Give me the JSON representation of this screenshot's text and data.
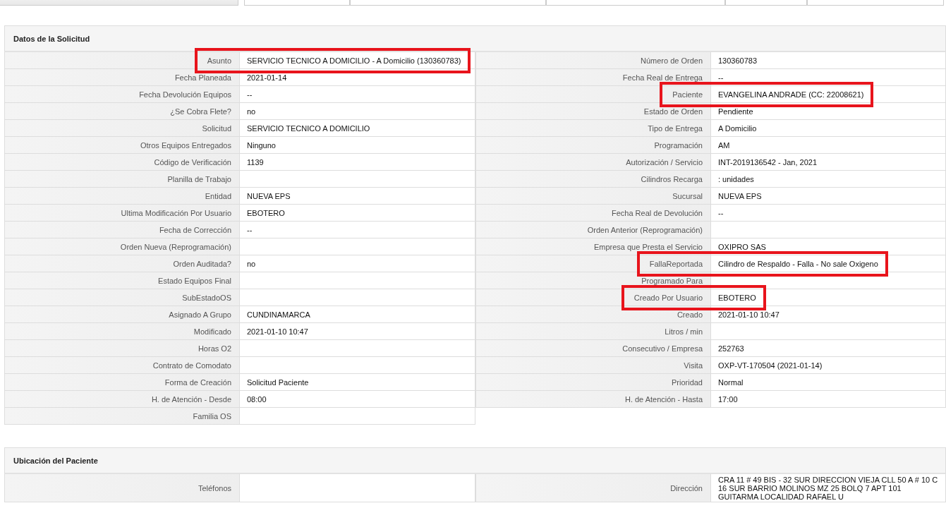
{
  "sections": [
    {
      "title": "Datos de la Solicitud",
      "rows": [
        [
          {
            "label": "Asunto",
            "value": "SERVICIO TECNICO A DOMICILIO - A Domicilio (130360783)",
            "highlighted": true
          },
          {
            "label": "Número de Orden",
            "value": "130360783",
            "highlighted": false
          }
        ],
        [
          {
            "label": "Fecha Planeada",
            "value": "2021-01-14",
            "highlighted": false
          },
          {
            "label": "Fecha Real de Entrega",
            "value": "--",
            "highlighted": false
          }
        ],
        [
          {
            "label": "Fecha Devolución Equipos",
            "value": "--",
            "highlighted": false
          },
          {
            "label": "Paciente",
            "value": "EVANGELINA ANDRADE (CC: 22008621)",
            "highlighted": true
          }
        ],
        [
          {
            "label": "¿Se Cobra Flete?",
            "value": "no",
            "highlighted": false
          },
          {
            "label": "Estado de Orden",
            "value": "Pendiente",
            "highlighted": false
          }
        ],
        [
          {
            "label": "Solicitud",
            "value": "SERVICIO TECNICO A DOMICILIO",
            "highlighted": false
          },
          {
            "label": "Tipo de Entrega",
            "value": "A Domicilio",
            "highlighted": false
          }
        ],
        [
          {
            "label": "Otros Equipos Entregados",
            "value": "Ninguno",
            "highlighted": false
          },
          {
            "label": "Programación",
            "value": "AM",
            "highlighted": false
          }
        ],
        [
          {
            "label": "Código de Verificación",
            "value": "1139",
            "highlighted": false
          },
          {
            "label": "Autorización / Servicio",
            "value": "INT-2019136542 - Jan, 2021",
            "highlighted": false
          }
        ],
        [
          {
            "label": "Planilla de Trabajo",
            "highlighted": false
          },
          {
            "label": "Cilindros Recarga",
            "value": ": unidades",
            "highlighted": false
          }
        ],
        [
          {
            "label": "Entidad",
            "value": "NUEVA EPS",
            "highlighted": false
          },
          {
            "label": "Sucursal",
            "value": "NUEVA EPS",
            "highlighted": false
          }
        ],
        [
          {
            "label": "Ultima Modificación Por Usuario",
            "value": "EBOTERO",
            "highlighted": false
          },
          {
            "label": "Fecha Real de Devolución",
            "value": "--",
            "highlighted": false
          }
        ],
        [
          {
            "label": "Fecha de Corrección",
            "value": "--",
            "highlighted": false
          },
          {
            "label": "Orden Anterior (Reprogramación)",
            "highlighted": false
          }
        ],
        [
          {
            "label": "Orden Nueva (Reprogramación)",
            "highlighted": false
          },
          {
            "label": "Empresa que Presta el Servicio",
            "value": "OXIPRO SAS",
            "highlighted": false
          }
        ],
        [
          {
            "label": "Orden Auditada?",
            "value": "no",
            "highlighted": false
          },
          {
            "label": "FallaReportada",
            "value": "Cilindro de Respaldo - Falla - No sale Oxigeno",
            "highlighted": true
          }
        ],
        [
          {
            "label": "Estado Equipos Final",
            "highlighted": false
          },
          {
            "label": "Programado Para",
            "highlighted": false
          }
        ],
        [
          {
            "label": "SubEstadoOS",
            "highlighted": false
          },
          {
            "label": "Creado Por Usuario",
            "value": "EBOTERO",
            "highlighted": true
          }
        ],
        [
          {
            "label": "Asignado A Grupo",
            "value": "CUNDINAMARCA",
            "highlighted": false
          },
          {
            "label": "Creado",
            "value": "2021-01-10 10:47",
            "highlighted": false
          }
        ],
        [
          {
            "label": "Modificado",
            "value": "2021-01-10 10:47",
            "highlighted": false
          },
          {
            "label": "Litros / min",
            "highlighted": false
          }
        ],
        [
          {
            "label": "Horas O2",
            "highlighted": false
          },
          {
            "label": "Consecutivo / Empresa",
            "value": "252763",
            "highlighted": false
          }
        ],
        [
          {
            "label": "Contrato de Comodato",
            "highlighted": false
          },
          {
            "label": "Visita",
            "value": "OXP-VT-170504 (2021-01-14)",
            "highlighted": false
          }
        ],
        [
          {
            "label": "Forma de Creación",
            "value": "Solicitud Paciente",
            "highlighted": false
          },
          {
            "label": "Prioridad",
            "value": "Normal",
            "highlighted": false
          }
        ],
        [
          {
            "label": "H. de Atención - Desde",
            "value": "08:00",
            "highlighted": false
          },
          {
            "label": "H. de Atención - Hasta",
            "value": "17:00",
            "highlighted": false
          }
        ],
        [
          {
            "label": "Familia OS",
            "highlighted": false
          }
        ]
      ]
    },
    {
      "title": "Ubicación del Paciente",
      "rows": [
        [
          {
            "label": "Teléfonos",
            "highlighted": false
          },
          {
            "label": "Dirección",
            "value": "CRA 11 # 49 BIS - 32 SUR DIRECCION VIEJA CLL 50 A # 10 C 16 SUR BARRIO MOLINOS MZ 25 BOLQ 7 APT 101 GUITARMA LOCALIDAD RAFAEL U",
            "highlighted": false
          }
        ]
      ]
    }
  ]
}
